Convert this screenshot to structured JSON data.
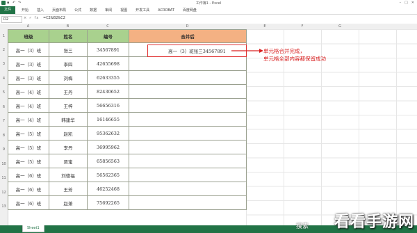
{
  "window": {
    "title": "工作簿1 - Excel"
  },
  "ribbon": {
    "file": "文件",
    "tabs": [
      "开始",
      "插入",
      "页面布局",
      "公式",
      "数据",
      "审阅",
      "视图",
      "开发工具",
      "ACROBAT",
      "百度网盘"
    ]
  },
  "formula": {
    "namebox": "D2",
    "fx": "× ✓ fx",
    "value": "=C2&B2&C2"
  },
  "columns": [
    "A",
    "B",
    "C",
    "D",
    "E",
    "F",
    "G"
  ],
  "rows": [
    "1",
    "2",
    "3",
    "4",
    "5",
    "6",
    "7",
    "8",
    "9",
    "10",
    "11",
    "12",
    "13"
  ],
  "table": {
    "headers": [
      "班级",
      "姓名",
      "编号",
      "合并后"
    ],
    "rows": [
      [
        "高一（3）班",
        "张三",
        "34567891"
      ],
      [
        "高一（3）班",
        "李四",
        "42655698"
      ],
      [
        "高一（3）班",
        "刘梅",
        "62633355"
      ],
      [
        "高一（4）班",
        "王丹",
        "82430652"
      ],
      [
        "高一（4）班",
        "王梓",
        "56656316"
      ],
      [
        "高一（4）班",
        "韩建华",
        "16146655"
      ],
      [
        "高一（5）班",
        "赵凯",
        "95362632"
      ],
      [
        "高一（5）班",
        "李丹",
        "36995962"
      ],
      [
        "高一（5）班",
        "贾宝",
        "65856563"
      ],
      [
        "高一（6）班",
        "刘德福",
        "56562365"
      ],
      [
        "高一（6）班",
        "王芳",
        "46252468"
      ],
      [
        "高一（6）班",
        "赵萧",
        "75692265"
      ]
    ]
  },
  "merged_value": "高一（3）班张三34567891",
  "annotation": {
    "line1": "单元格合并完成，",
    "line2": "单元格全部内容都保留成功"
  },
  "sheet": {
    "tab": "Sheet1"
  },
  "watermark": {
    "search": "搜索",
    "text": "看看手游网"
  },
  "colors": {
    "header_green": "#a9d18e",
    "header_orange": "#f4b183",
    "accent_red": "#d92020",
    "excel_green": "#217346"
  }
}
